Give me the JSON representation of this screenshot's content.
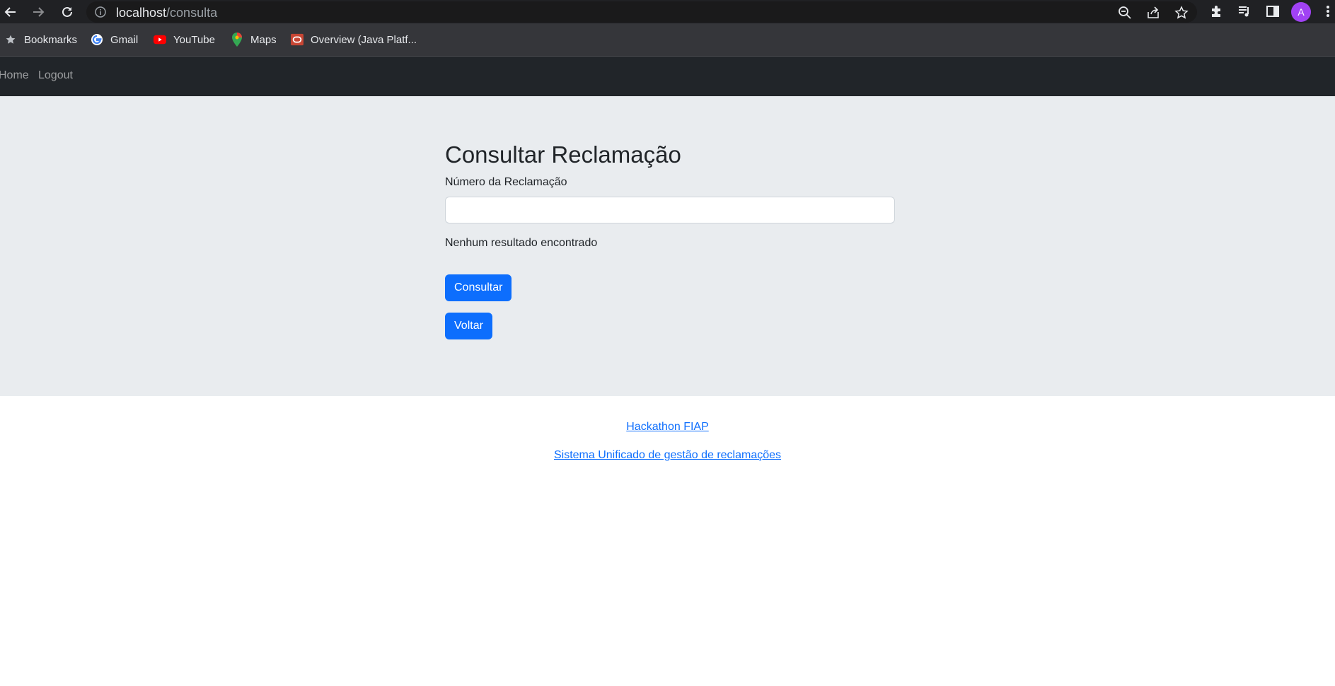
{
  "browser": {
    "url_host": "localhost",
    "url_path": "/consulta",
    "avatar_letter": "A",
    "bookmarks": [
      {
        "label": "Bookmarks",
        "icon": "star-icon"
      },
      {
        "label": "Gmail",
        "icon": "google-icon"
      },
      {
        "label": "YouTube",
        "icon": "youtube-icon"
      },
      {
        "label": "Maps",
        "icon": "maps-pin-icon"
      },
      {
        "label": "Overview (Java Platf...",
        "icon": "oracle-icon"
      }
    ]
  },
  "nav": {
    "home": "Home",
    "logout": "Logout"
  },
  "page": {
    "title": "Consultar Reclamação",
    "field_label": "Número da Reclamação",
    "field_value": "",
    "result_text": "Nenhum resultado encontrado",
    "consultar_label": "Consultar",
    "voltar_label": "Voltar"
  },
  "footer": {
    "link1": "Hackathon FIAP",
    "link2": "Sistema Unificado de gestão de reclamações"
  },
  "colors": {
    "primary": "#0d6efd",
    "navbar": "#212529",
    "main_bg": "#e9ecef"
  }
}
